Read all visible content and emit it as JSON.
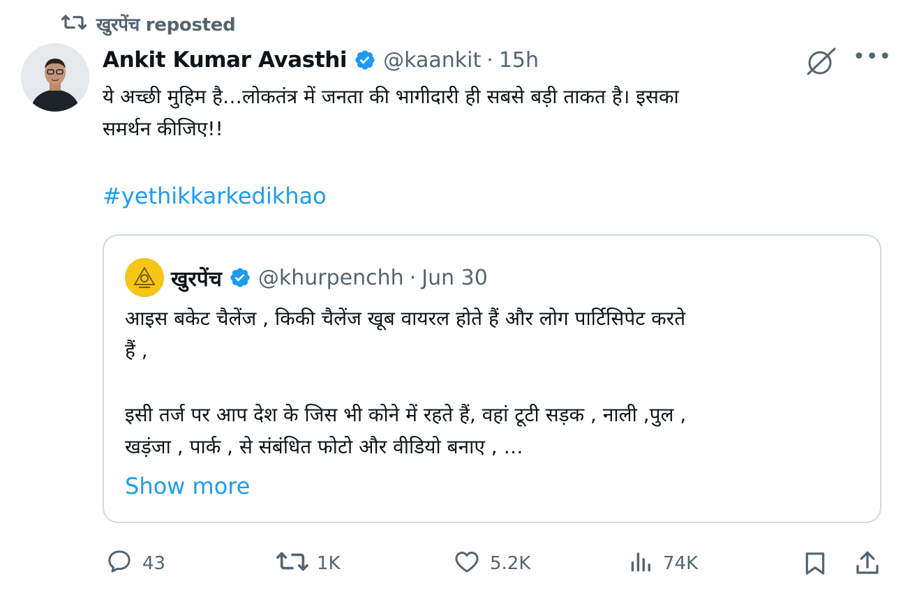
{
  "repost": {
    "label": "खुरपेंच reposted",
    "icon": "repost-icon"
  },
  "tweet": {
    "author_name": "Ankit Kumar Avasthi",
    "handle": "@kaankit",
    "separator": "·",
    "time": "15h",
    "text_line1": "ये अच्छी मुहिम है…लोकतंत्र में जनता की भागीदारी ही सबसे बड़ी ताकत है। इसका",
    "text_line2": "समर्थन कीजिए!!",
    "hashtag": "#yethikkarkedikhao",
    "more_label": "•••"
  },
  "quote": {
    "author_name": "खुरपेंच",
    "handle": "@khurpenchh",
    "separator": "·",
    "time": "Jun 30",
    "line1": "आइस बकेट चैलेंज , किकी चैलेंज खूब वायरल होते हैं और लोग पार्टिसिपेट करते",
    "line2": "हैं ,",
    "line3": "इसी तर्ज पर आप देश के जिस भी कोने में रहते हैं, वहां टूटी सड़क , नाली ,पुल ,",
    "line4": "खड़ंजा , पार्क , से संबंधित फोटो और वीडियो बनाए , …",
    "show_more": "Show more"
  },
  "actions": {
    "replies": "43",
    "reposts": "1K",
    "likes": "5.2K",
    "views": "74K"
  },
  "colors": {
    "accent": "#1d9bf0",
    "muted": "#536471",
    "text": "#0f1419",
    "border": "#cfd9de",
    "quote_avatar": "#f5c518"
  }
}
